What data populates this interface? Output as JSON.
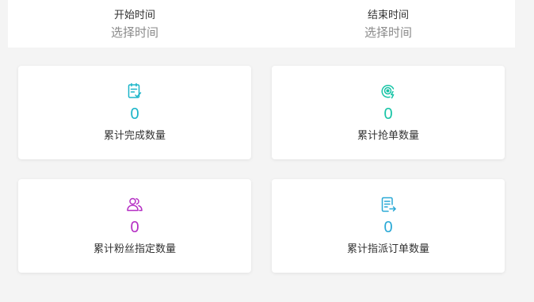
{
  "date_filter": {
    "start_label": "开始时间",
    "start_placeholder": "选择时间",
    "end_label": "结束时间",
    "end_placeholder": "选择时间"
  },
  "stats": [
    {
      "value": "0",
      "label": "累计完成数量",
      "icon": "checklist-icon",
      "color": "#1cb5c9"
    },
    {
      "value": "0",
      "label": "累计抢单数量",
      "icon": "grab-order-icon",
      "color": "#18c4a6"
    },
    {
      "value": "0",
      "label": "累计粉丝指定数量",
      "icon": "users-icon",
      "color": "#b52fc4"
    },
    {
      "value": "0",
      "label": "累计指派订单数量",
      "icon": "assign-document-icon",
      "color": "#2aa9d6"
    }
  ]
}
